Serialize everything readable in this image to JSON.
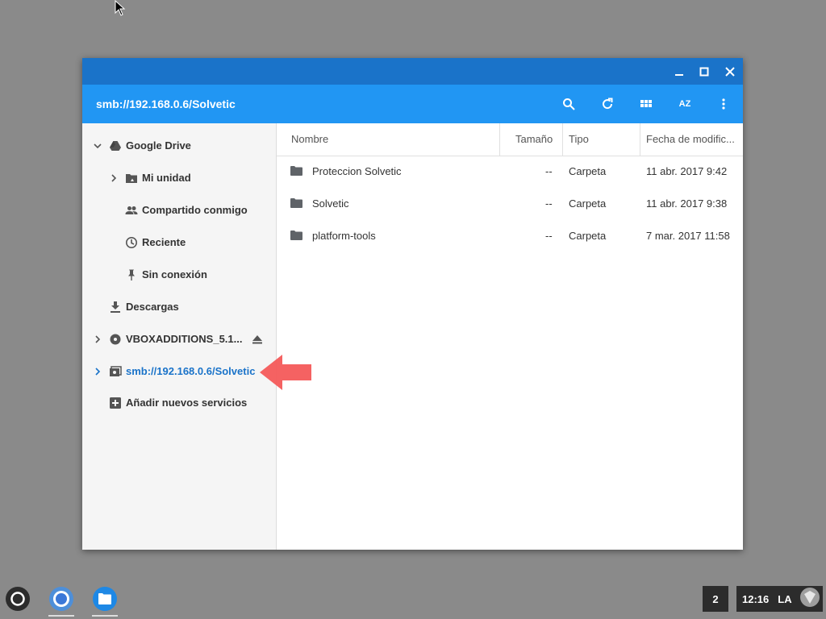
{
  "window": {
    "path": "smb://192.168.0.6/Solvetic"
  },
  "sidebar": {
    "items": [
      {
        "label": "Google Drive"
      },
      {
        "label": "Mi unidad"
      },
      {
        "label": "Compartido conmigo"
      },
      {
        "label": "Reciente"
      },
      {
        "label": "Sin conexión"
      },
      {
        "label": "Descargas"
      },
      {
        "label": "VBOXADDITIONS_5.1..."
      },
      {
        "label": "smb://192.168.0.6/Solvetic"
      },
      {
        "label": "Añadir nuevos servicios"
      }
    ],
    "active_item": "smb://192.168.0.6/Solvetic"
  },
  "file_list": {
    "columns": [
      "Nombre",
      "Tamaño",
      "Tipo",
      "Fecha de modific..."
    ],
    "rows": [
      {
        "name": "Proteccion Solvetic",
        "size": "--",
        "type": "Carpeta",
        "date": "11 abr. 2017 9:42"
      },
      {
        "name": "Solvetic",
        "size": "--",
        "type": "Carpeta",
        "date": "11 abr. 2017 9:38"
      },
      {
        "name": "platform-tools",
        "size": "--",
        "type": "Carpeta",
        "date": "7 mar. 2017 11:58"
      }
    ]
  },
  "toolbar": {
    "sort_label": "AZ"
  },
  "taskbar": {
    "workspace_count": "2",
    "time": "12:16",
    "ime": "LA"
  },
  "colors": {
    "titlebar": "#1a73c9",
    "toolbar": "#2196f3",
    "active": "#1a73c9",
    "annotation_arrow": "#f45a5a"
  },
  "icons": [
    "minimize-icon",
    "maximize-icon",
    "close-icon",
    "search-icon",
    "refresh-icon",
    "grid-view-icon",
    "sort-icon",
    "more-icon",
    "google-drive-icon",
    "my-drive-icon",
    "shared-icon",
    "recent-icon",
    "pin-icon",
    "download-icon",
    "disc-icon",
    "eject-icon",
    "network-share-icon",
    "add-icon",
    "folder-icon",
    "launcher-icon",
    "chrome-icon",
    "files-app-icon"
  ]
}
